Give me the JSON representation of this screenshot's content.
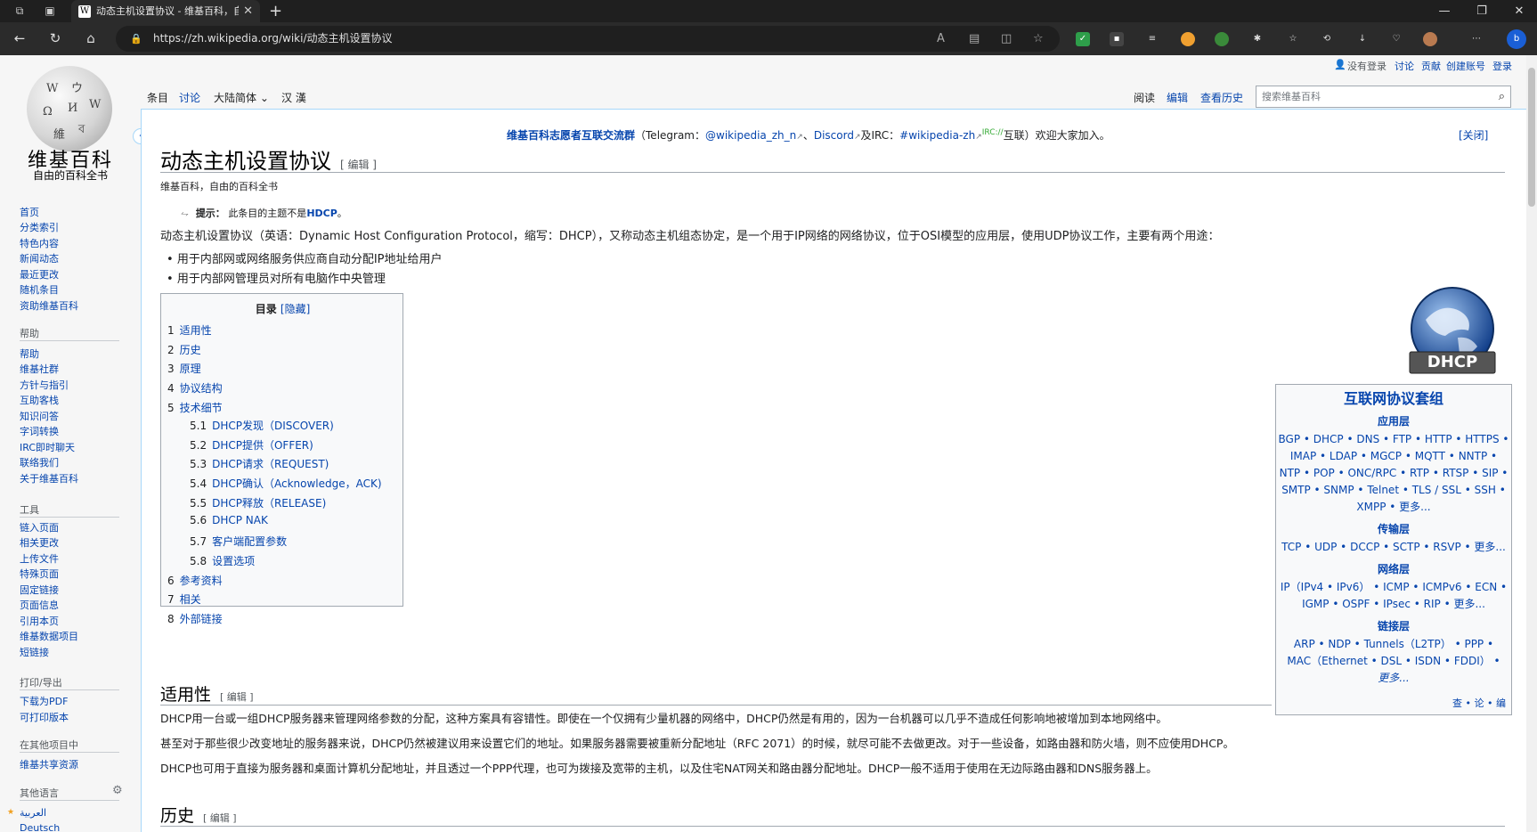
{
  "browser": {
    "tab_title": "动态主机设置协议 - 维基百科，自",
    "url": "https://zh.wikipedia.org/wiki/动态主机设置协议",
    "favicon_letter": "W"
  },
  "personal": {
    "not_logged": "没有登录",
    "talk": "讨论",
    "contrib": "贡献",
    "create": "创建账号",
    "login": "登录"
  },
  "page_tabs": {
    "article": "条目",
    "talk": "讨论",
    "variant": "大陆简体",
    "hanzi": "汉 漢",
    "read": "阅读",
    "edit": "编辑",
    "history": "查看历史"
  },
  "search": {
    "placeholder": "搜索维基百科"
  },
  "sidebar": {
    "logo_title": "维基百科",
    "logo_sub": "自由的百科全书",
    "main": [
      "首页",
      "分类索引",
      "特色内容",
      "新闻动态",
      "最近更改",
      "随机条目",
      "资助维基百科"
    ],
    "help_h": "帮助",
    "help": [
      "帮助",
      "维基社群",
      "方针与指引",
      "互助客栈",
      "知识问答",
      "字词转换",
      "IRC即时聊天",
      "联络我们",
      "关于维基百科"
    ],
    "tools_h": "工具",
    "tools": [
      "链入页面",
      "相关更改",
      "上传文件",
      "特殊页面",
      "固定链接",
      "页面信息",
      "引用本页",
      "维基数据项目",
      "短链接"
    ],
    "print_h": "打印/导出",
    "print": [
      "下载为PDF",
      "可打印版本"
    ],
    "other_h": "在其他项目中",
    "other": [
      "维基共享资源"
    ],
    "lang_h": "其他语言",
    "lang": [
      "العربية",
      "Deutsch"
    ]
  },
  "notice": {
    "bold": "维基百科志愿者互联交流群",
    "mid": "（Telegram：",
    "tg": "@wikipedia_zh_n",
    "sep": "、",
    "discord": "Discord",
    "and": "及IRC：",
    "irc": "#wikipedia-zh",
    "irc_sup": "IRC://",
    "tail": "互联）欢迎大家加入。",
    "close": "[关闭]"
  },
  "article": {
    "title": "动态主机设置协议",
    "edit": "[ 编辑 ]",
    "from": "维基百科，自由的百科全书",
    "hint_label": "提示：",
    "hint_text": "此条目的主题不是",
    "hint_link": "HDCP",
    "hint_end": "。",
    "intro": "动态主机设置协议（英语：Dynamic Host Configuration Protocol，缩写：DHCP），又称动态主机组态协定，是一个用于IP网络的网络协议，位于OSI模型的应用层，使用UDP协议工作，主要有两个用途：",
    "bullet1": "用于内部网或网络服务供应商自动分配IP地址给用户",
    "bullet2": "用于内部网管理员对所有电脑作中央管理"
  },
  "toc": {
    "title": "目录",
    "hide": "[隐藏]",
    "items": [
      {
        "n": "1",
        "t": "适用性"
      },
      {
        "n": "2",
        "t": "历史"
      },
      {
        "n": "3",
        "t": "原理"
      },
      {
        "n": "4",
        "t": "协议结构"
      },
      {
        "n": "5",
        "t": "技术细节"
      },
      {
        "n": "5.1",
        "t": "DHCP发现（DISCOVER)"
      },
      {
        "n": "5.2",
        "t": "DHCP提供（OFFER)"
      },
      {
        "n": "5.3",
        "t": "DHCP请求（REQUEST)"
      },
      {
        "n": "5.4",
        "t": "DHCP确认（Acknowledge，ACK)"
      },
      {
        "n": "5.5",
        "t": "DHCP释放（RELEASE)"
      },
      {
        "n": "5.6",
        "t": "DHCP NAK"
      },
      {
        "n": "5.7",
        "t": "客户端配置参数"
      },
      {
        "n": "5.8",
        "t": "设置选项"
      },
      {
        "n": "6",
        "t": "参考资料"
      },
      {
        "n": "7",
        "t": "相关"
      },
      {
        "n": "8",
        "t": "外部链接"
      }
    ]
  },
  "sec1": {
    "title": "适用性",
    "edit": "[ 编辑 ]",
    "p1": "DHCP用一台或一组DHCP服务器来管理网络参数的分配，这种方案具有容错性。即使在一个仅拥有少量机器的网络中，DHCP仍然是有用的，因为一台机器可以几乎不造成任何影响地被增加到本地网络中。",
    "p2": "甚至对于那些很少改变地址的服务器来说，DHCP仍然被建议用来设置它们的地址。如果服务器需要被重新分配地址（RFC 2071）的时候，就尽可能不去做更改。对于一些设备，如路由器和防火墙，则不应使用DHCP。",
    "p3": "DHCP也可用于直接为服务器和桌面计算机分配地址，并且透过一个PPP代理，也可为拨接及宽带的主机，以及住宅NAT网关和路由器分配地址。DHCP一般不适用于使用在无边际路由器和DNS服务器上。"
  },
  "sec2": {
    "title": "历史",
    "edit": "[ 编辑 ]"
  },
  "infobox": {
    "logo_text": "DHCP"
  },
  "navbox": {
    "title": "互联网协议套组",
    "app_h": "应用层",
    "app": [
      "BGP • DHCP • DNS • FTP • HTTP • HTTPS •",
      "IMAP • LDAP • MGCP • MQTT • NNTP •",
      "NTP • POP • ONC/RPC • RTP • RTSP • SIP •",
      "SMTP • SNMP • Telnet • TLS / SSL • SSH •",
      "XMPP • 更多..."
    ],
    "tr_h": "传输层",
    "tr": [
      "TCP • UDP • DCCP • SCTP • RSVP • 更多..."
    ],
    "net_h": "网络层",
    "net": [
      "IP（IPv4 • IPv6） • ICMP • ICMPv6 • ECN •",
      "IGMP • OSPF • IPsec • RIP • 更多..."
    ],
    "link_h": "链接层",
    "link": [
      "ARP • NDP • Tunnels（L2TP） • PPP •",
      "MAC（Ethernet • DSL • ISDN • FDDI） •",
      "更多..."
    ],
    "vte": "查 • 论 • 编"
  }
}
